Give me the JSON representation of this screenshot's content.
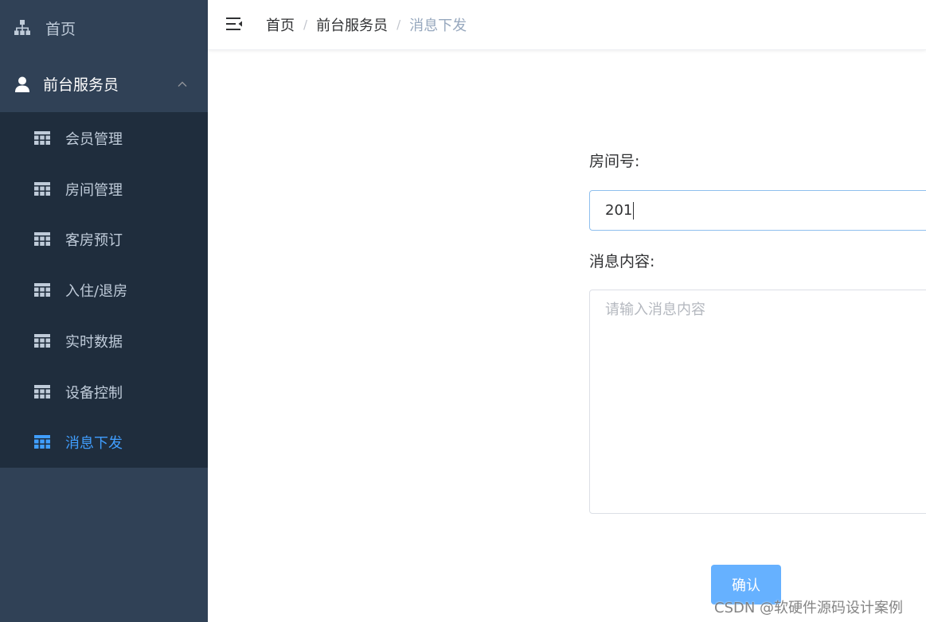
{
  "sidebar": {
    "home": {
      "label": "首页",
      "icon": "sitemap-icon"
    },
    "group": {
      "label": "前台服务员",
      "icon": "user-icon",
      "expanded": true
    },
    "items": [
      {
        "label": "会员管理",
        "icon": "grid-icon",
        "active": false
      },
      {
        "label": "房间管理",
        "icon": "grid-icon",
        "active": false
      },
      {
        "label": "客房预订",
        "icon": "grid-icon",
        "active": false
      },
      {
        "label": "入住/退房",
        "icon": "grid-icon",
        "active": false
      },
      {
        "label": "实时数据",
        "icon": "grid-icon",
        "active": false
      },
      {
        "label": "设备控制",
        "icon": "grid-icon",
        "active": false
      },
      {
        "label": "消息下发",
        "icon": "grid-icon",
        "active": true
      }
    ]
  },
  "navbar": {
    "breadcrumb": [
      "首页",
      "前台服务员",
      "消息下发"
    ],
    "separator": "/"
  },
  "form": {
    "room_label": "房间号:",
    "room_value": "201",
    "content_label": "消息内容:",
    "content_placeholder": "请输入消息内容",
    "content_value": "",
    "confirm_label": "确认"
  },
  "watermark": "CSDN @软硬件源码设计案例",
  "colors": {
    "sidebar_bg": "#304156",
    "submenu_bg": "#1f2d3d",
    "sidebar_text": "#bfcbd9",
    "active": "#409eff",
    "button": "#66b1ff",
    "breadcrumb_current": "#97a8be"
  }
}
